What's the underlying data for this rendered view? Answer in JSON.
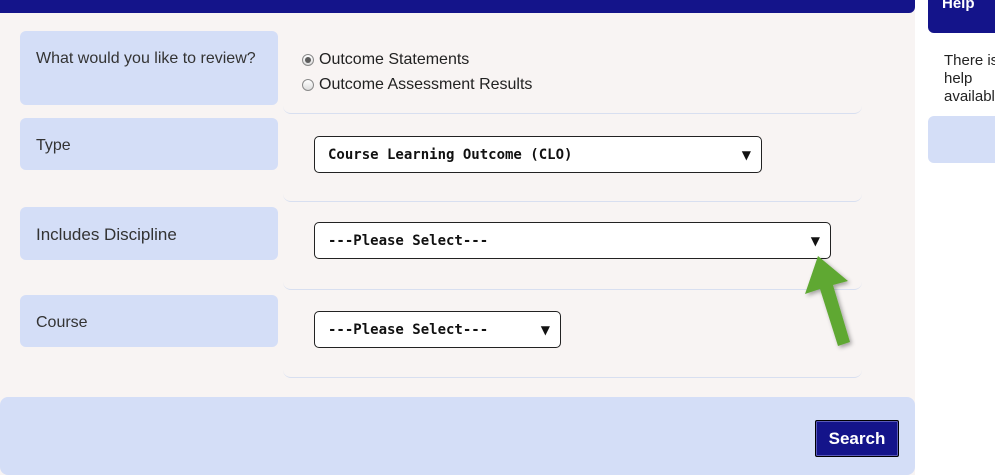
{
  "form": {
    "review": {
      "label": "What would you like to review?",
      "options": [
        {
          "label": "Outcome Statements",
          "selected": true
        },
        {
          "label": "Outcome Assessment Results",
          "selected": false
        }
      ]
    },
    "type": {
      "label": "Type",
      "value": "Course Learning Outcome (CLO)"
    },
    "discipline": {
      "label": "Includes Discipline",
      "value": "---Please Select---"
    },
    "course": {
      "label": "Course",
      "value": "---Please Select---"
    },
    "search_label": "Search"
  },
  "help": {
    "title": "Help",
    "body": "There is no help available"
  },
  "colors": {
    "accent": "#14148a",
    "panel": "#d4def7",
    "background": "#f8f4f3",
    "arrow": "#5fa833"
  },
  "annotation": {
    "icon": "green-arrow-icon"
  }
}
